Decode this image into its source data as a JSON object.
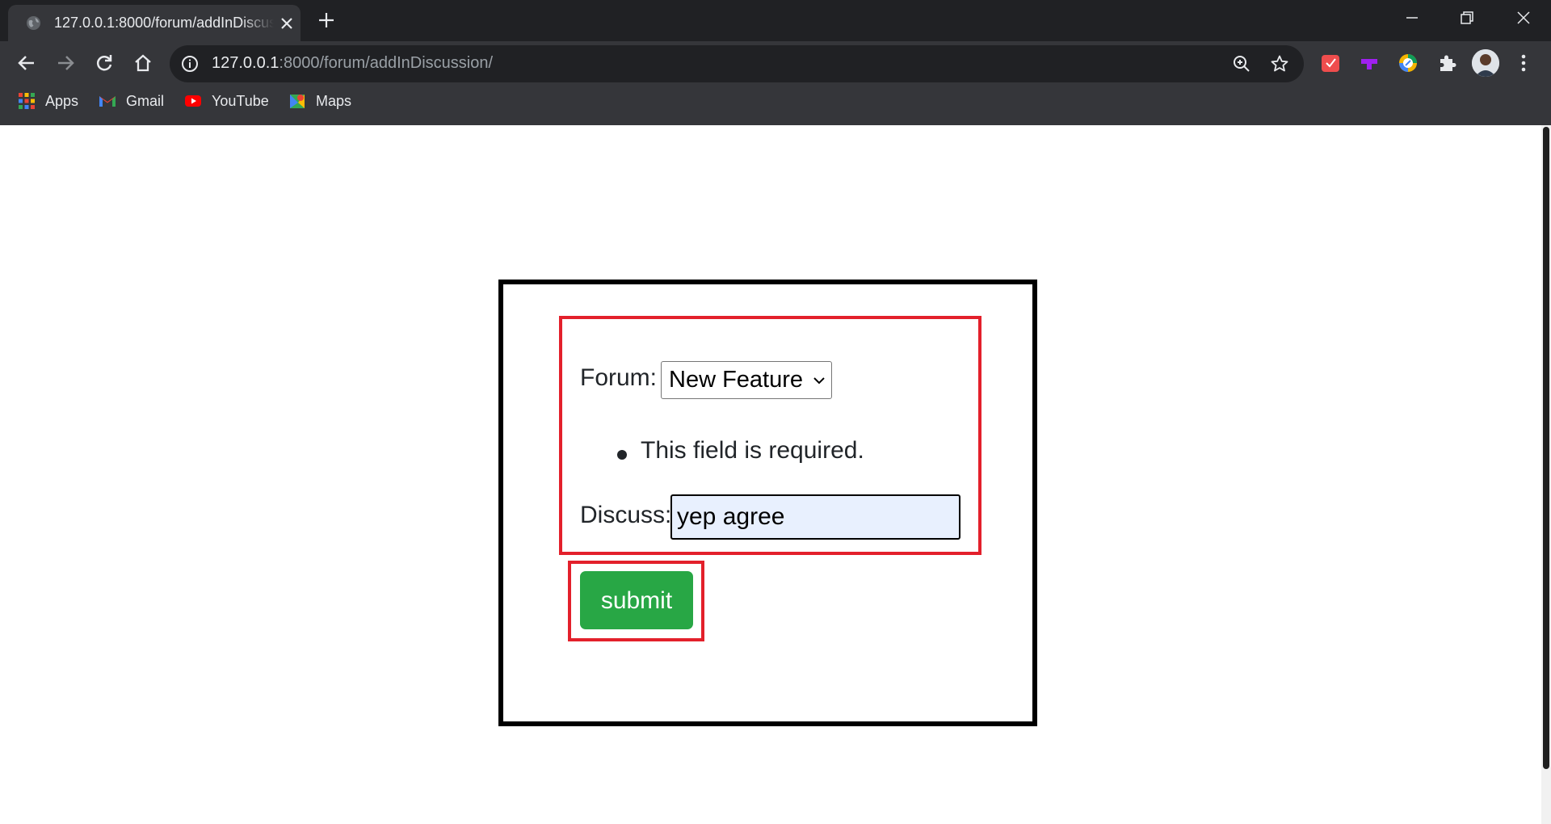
{
  "browser": {
    "tab": {
      "title": "127.0.0.1:8000/forum/addInDiscussion/"
    },
    "address_bar": {
      "host": "127.0.0.1",
      "path": ":8000/forum/addInDiscussion/"
    },
    "bookmarks": [
      {
        "label": "Apps",
        "icon": "apps-grid-icon"
      },
      {
        "label": "Gmail",
        "icon": "gmail-icon"
      },
      {
        "label": "YouTube",
        "icon": "youtube-icon"
      },
      {
        "label": "Maps",
        "icon": "maps-icon"
      }
    ],
    "extensions": [
      "red-extension-icon",
      "purple-extension-icon",
      "colorful-extension-icon",
      "puzzle-extensions-icon"
    ]
  },
  "form": {
    "forum_label": "Forum:",
    "forum_selected": "New Feature",
    "error_message": "This field is required.",
    "discuss_label": "Discuss:",
    "discuss_value": "yep agree",
    "submit_label": "submit"
  },
  "colors": {
    "annotation_red": "#e3202b",
    "submit_green": "#28a745",
    "autofill_blue": "#e8f0fe"
  }
}
